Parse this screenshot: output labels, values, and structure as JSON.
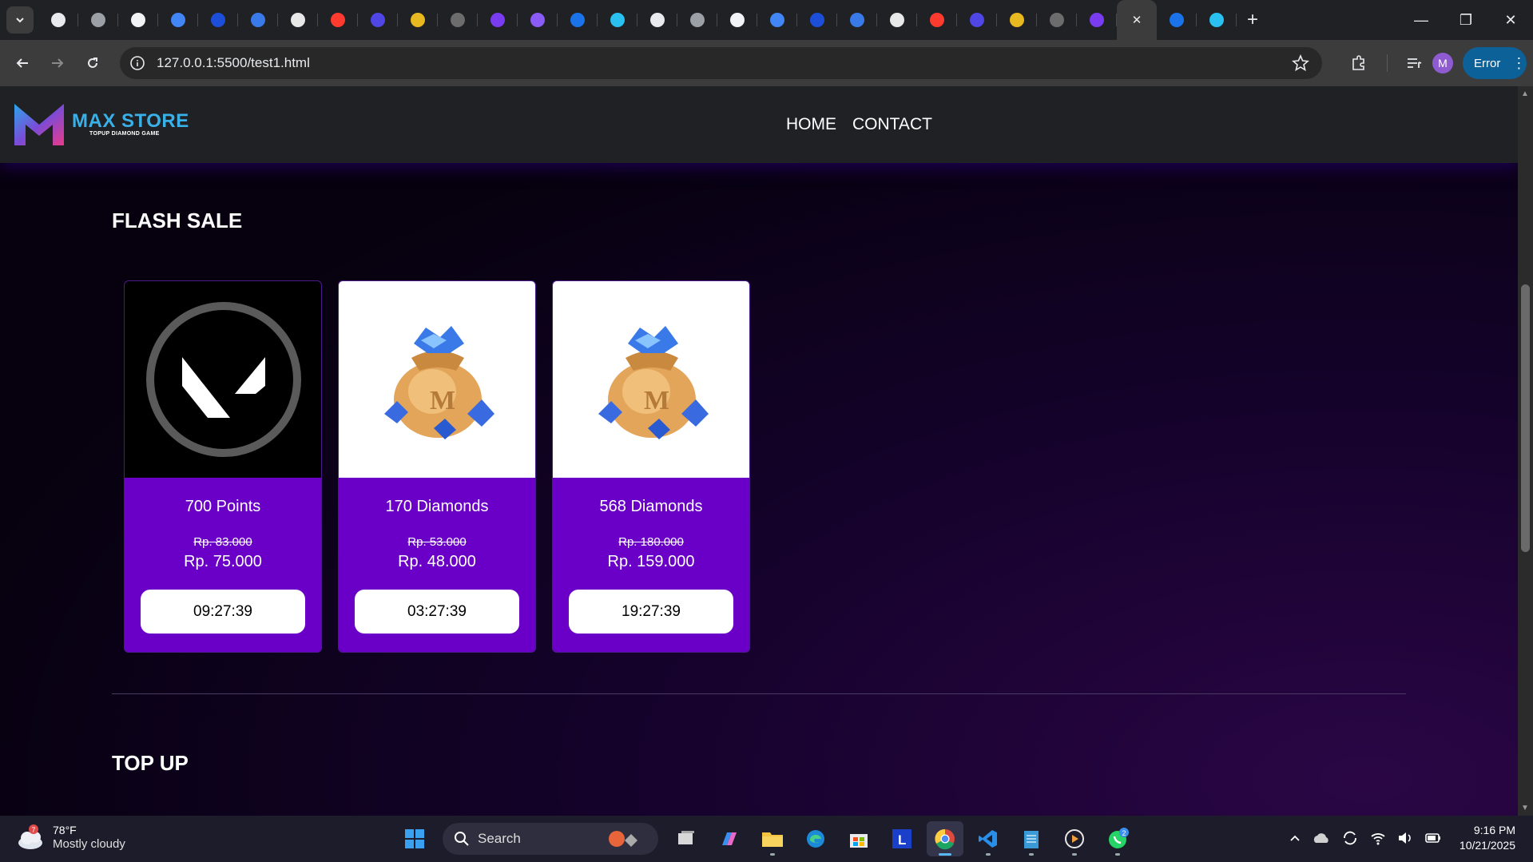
{
  "browser": {
    "url": "127.0.0.1:5500/test1.html",
    "error_label": "Error",
    "profile_initial": "M",
    "tab_count": 30
  },
  "site": {
    "logo_name": "MAX STORE",
    "logo_tagline": "TOPUP DIAMOND GAME",
    "nav": [
      "HOME",
      "CONTACT"
    ]
  },
  "flash_sale": {
    "title": "FLASH SALE",
    "items": [
      {
        "name": "700 Points",
        "old_price": "Rp. 83.000",
        "new_price": "Rp. 75.000",
        "timer": "09:27:39",
        "image": "valorant-logo"
      },
      {
        "name": "170 Diamonds",
        "old_price": "Rp. 53.000",
        "new_price": "Rp. 48.000",
        "timer": "03:27:39",
        "image": "diamond-bag"
      },
      {
        "name": "568 Diamonds",
        "old_price": "Rp. 180.000",
        "new_price": "Rp. 159.000",
        "timer": "19:27:39",
        "image": "diamond-bag"
      }
    ]
  },
  "topup": {
    "title": "TOP UP"
  },
  "taskbar": {
    "weather_temp": "78°F",
    "weather_desc": "Mostly cloudy",
    "weather_badge": "7",
    "search_placeholder": "Search",
    "whatsapp_badge": "2",
    "time": "9:16 PM",
    "date": "10/21/2025"
  },
  "colors": {
    "card_purple": "#6a00c8",
    "logo_blue": "#3ab0e8",
    "error_button": "#0d6199"
  }
}
